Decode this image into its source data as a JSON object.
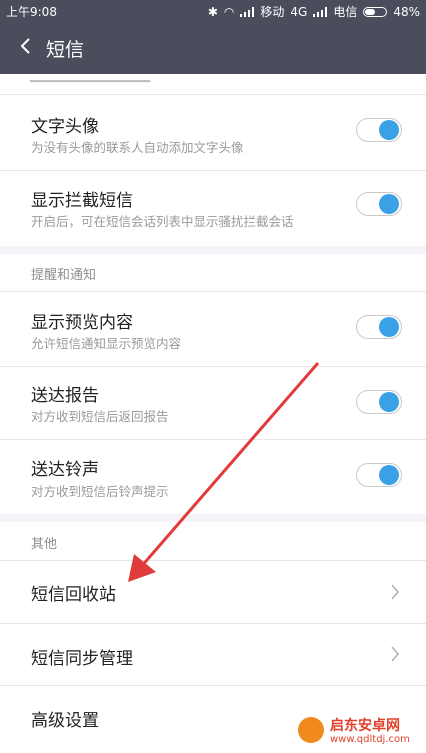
{
  "status": {
    "time": "上午9:08",
    "carrier1": "移动",
    "network": "4G",
    "carrier2": "电信",
    "battery": "48%"
  },
  "titlebar": {
    "title": "短信"
  },
  "rows": {
    "text_avatar": {
      "label": "文字头像",
      "sub": "为没有头像的联系人自动添加文字头像",
      "on": true
    },
    "show_blocked": {
      "label": "显示拦截短信",
      "sub": "开启后，可在短信会话列表中显示骚扰拦截会话",
      "on": true
    },
    "preview": {
      "label": "显示预览内容",
      "sub": "允许短信通知显示预览内容",
      "on": true
    },
    "delivery_report": {
      "label": "送达报告",
      "sub": "对方收到短信后返回报告",
      "on": true
    },
    "delivery_tone": {
      "label": "送达铃声",
      "sub": "对方收到短信后铃声提示",
      "on": true
    },
    "recycle_bin": {
      "label": "短信回收站"
    },
    "sync": {
      "label": "短信同步管理"
    },
    "advanced": {
      "label": "高级设置"
    }
  },
  "headers": {
    "notify": "提醒和通知",
    "other": "其他"
  },
  "watermark": {
    "title": "启东安卓网",
    "url": "www.qdltdj.com"
  },
  "colors": {
    "toggle_on": "#3aa1e6",
    "titlebar": "#4a4e5c",
    "annotation_arrow": "#e23b3b"
  }
}
